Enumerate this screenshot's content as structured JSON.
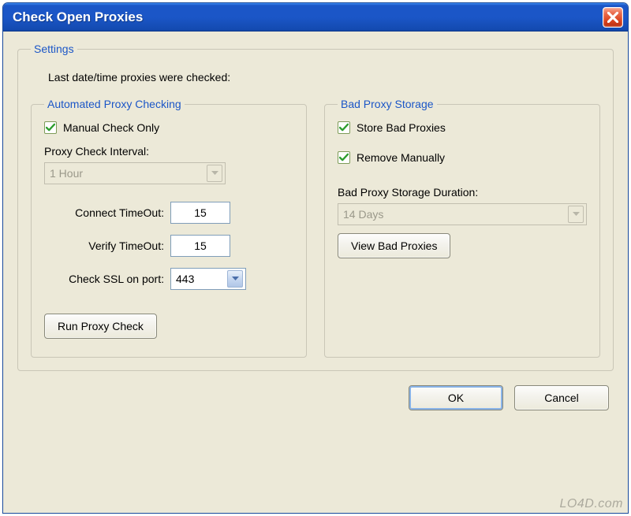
{
  "window": {
    "title": "Check Open Proxies"
  },
  "settings": {
    "legend": "Settings",
    "last_checked_label": "Last date/time proxies were checked:"
  },
  "automated": {
    "legend": "Automated Proxy Checking",
    "manual_check_only_label": "Manual Check Only",
    "interval_label": "Proxy Check Interval:",
    "interval_value": "1 Hour",
    "connect_timeout_label": "Connect TimeOut:",
    "connect_timeout_value": "15",
    "verify_timeout_label": "Verify TimeOut:",
    "verify_timeout_value": "15",
    "ssl_port_label": "Check SSL on port:",
    "ssl_port_value": "443",
    "run_button": "Run Proxy Check"
  },
  "bad_storage": {
    "legend": "Bad Proxy Storage",
    "store_label": "Store Bad Proxies",
    "remove_label": "Remove Manually",
    "duration_label": "Bad Proxy Storage Duration:",
    "duration_value": "14 Days",
    "view_button": "View Bad Proxies"
  },
  "buttons": {
    "ok": "OK",
    "cancel": "Cancel"
  },
  "watermark": "LO4D.com"
}
